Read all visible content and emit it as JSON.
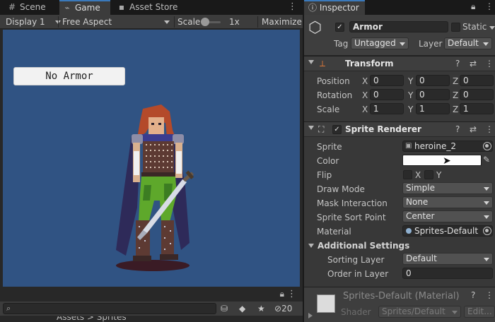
{
  "tabs": [
    {
      "label": "Scene",
      "icon": "#"
    },
    {
      "label": "Game",
      "icon": "⌁"
    },
    {
      "label": "Asset Store",
      "icon": "▪"
    }
  ],
  "game_toolbar": {
    "display": "Display 1",
    "aspect": "Free Aspect",
    "scale_label": "Scale",
    "scale_value": "1x",
    "scale_fraction": 0.1,
    "maximize": "Maximize"
  },
  "game_view": {
    "button_label": "No Armor",
    "background_color": "#305383"
  },
  "project_bar": {
    "hidden_count": "20"
  },
  "breadcrumb": "Assets > Sprites",
  "inspector": {
    "tab_label": "Inspector",
    "object": {
      "active": true,
      "name": "Armor",
      "static_label": "Static",
      "tag_label": "Tag",
      "tag_value": "Untagged",
      "layer_label": "Layer",
      "layer_value": "Default"
    },
    "transform": {
      "title": "Transform",
      "rows": [
        {
          "label": "Position",
          "x": "0",
          "y": "0",
          "z": "0"
        },
        {
          "label": "Rotation",
          "x": "0",
          "y": "0",
          "z": "0"
        },
        {
          "label": "Scale",
          "x": "1",
          "y": "1",
          "z": "1"
        }
      ]
    },
    "sprite_renderer": {
      "title": "Sprite Renderer",
      "enabled": true,
      "sprite_label": "Sprite",
      "sprite_value": "heroine_2",
      "color_label": "Color",
      "color_value": "#ffffff",
      "flip_label": "Flip",
      "flip_x": "X",
      "flip_y": "Y",
      "draw_mode_label": "Draw Mode",
      "draw_mode_value": "Simple",
      "mask_label": "Mask Interaction",
      "mask_value": "None",
      "sort_point_label": "Sprite Sort Point",
      "sort_point_value": "Center",
      "material_label": "Material",
      "material_value": "Sprites-Default",
      "additional_label": "Additional Settings",
      "sorting_layer_label": "Sorting Layer",
      "sorting_layer_value": "Default",
      "order_label": "Order in Layer",
      "order_value": "0"
    },
    "material": {
      "name": "Sprites-Default (Material)",
      "shader_label": "Shader",
      "shader_value": "Sprites/Default",
      "edit_label": "Edit..."
    }
  }
}
